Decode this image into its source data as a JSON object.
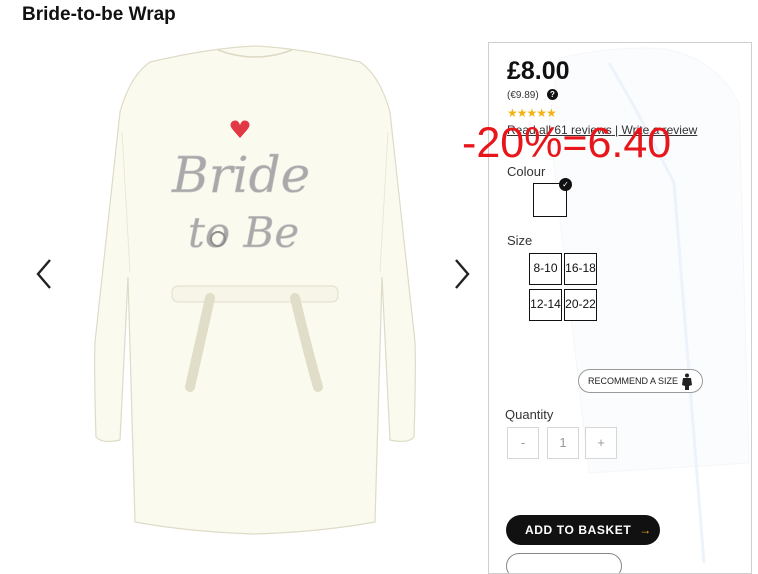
{
  "product": {
    "title": "Bride-to-be Wrap",
    "image_text": "Bride to Be"
  },
  "nav": {
    "prev_icon": "chevron-left",
    "next_icon": "chevron-right"
  },
  "pricing": {
    "price": "£8.00",
    "euro_price": "(€9.89)",
    "help_icon": "?",
    "rating": 4.5,
    "stars": "★★★★★",
    "read_reviews": "Read all 61 reviews",
    "separator": " | ",
    "write_review": "Write a review"
  },
  "promo": {
    "text": "-20%=6.40",
    "color": "#e8161b"
  },
  "colour": {
    "label": "Colour",
    "selected_icon": "✓"
  },
  "size": {
    "label": "Size",
    "options": [
      "8-10",
      "16-18",
      "12-14",
      "20-22"
    ]
  },
  "recommend": {
    "label": "RECOMMEND A SIZE",
    "icon": "mannequin-icon"
  },
  "quantity": {
    "label": "Quantity",
    "minus": "-",
    "value": "1",
    "plus": "+"
  },
  "basket": {
    "label": "ADD TO BASKET",
    "arrow": "→"
  },
  "colors": {
    "accent": "#f3b316",
    "primary": "#111111",
    "garment": "#fbfaef"
  }
}
